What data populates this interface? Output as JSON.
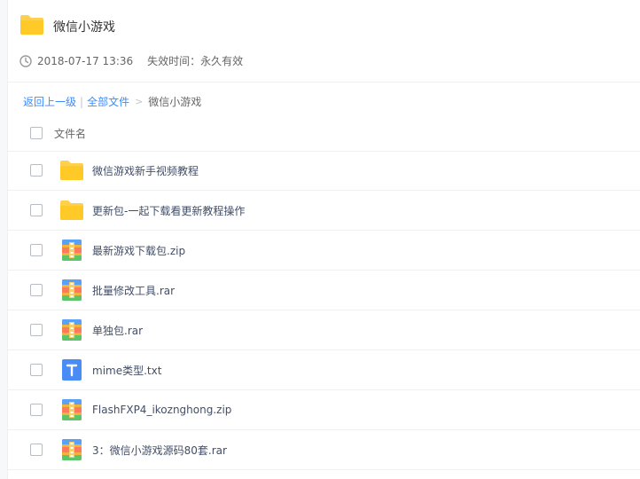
{
  "share": {
    "title": "微信小游戏",
    "date": "2018-07-17 13:36",
    "expire": "失效时间：永久有效"
  },
  "breadcrumb": {
    "back": "返回上一级",
    "separator": "|",
    "all_files": "全部文件",
    "arrow": ">",
    "current": "微信小游戏"
  },
  "list": {
    "column_name": "文件名",
    "files": [
      {
        "name": "微信游戏新手视频教程",
        "icon": "folder-icon"
      },
      {
        "name": "更新包-一起下载看更新教程操作",
        "icon": "folder-icon"
      },
      {
        "name": "最新游戏下载包.zip",
        "icon": "archive-icon"
      },
      {
        "name": "批量修改工具.rar",
        "icon": "archive-icon"
      },
      {
        "name": "单独包.rar",
        "icon": "archive-icon"
      },
      {
        "name": "mime类型.txt",
        "icon": "text-file-icon"
      },
      {
        "name": "FlashFXP4_ikoznghong.zip",
        "icon": "archive-icon"
      },
      {
        "name": "3：微信小游戏源码80套.rar",
        "icon": "archive-icon"
      }
    ]
  },
  "colors": {
    "link": "#3b8cff",
    "folder": "#ffd04b",
    "text_icon": "#4a8cf6"
  }
}
